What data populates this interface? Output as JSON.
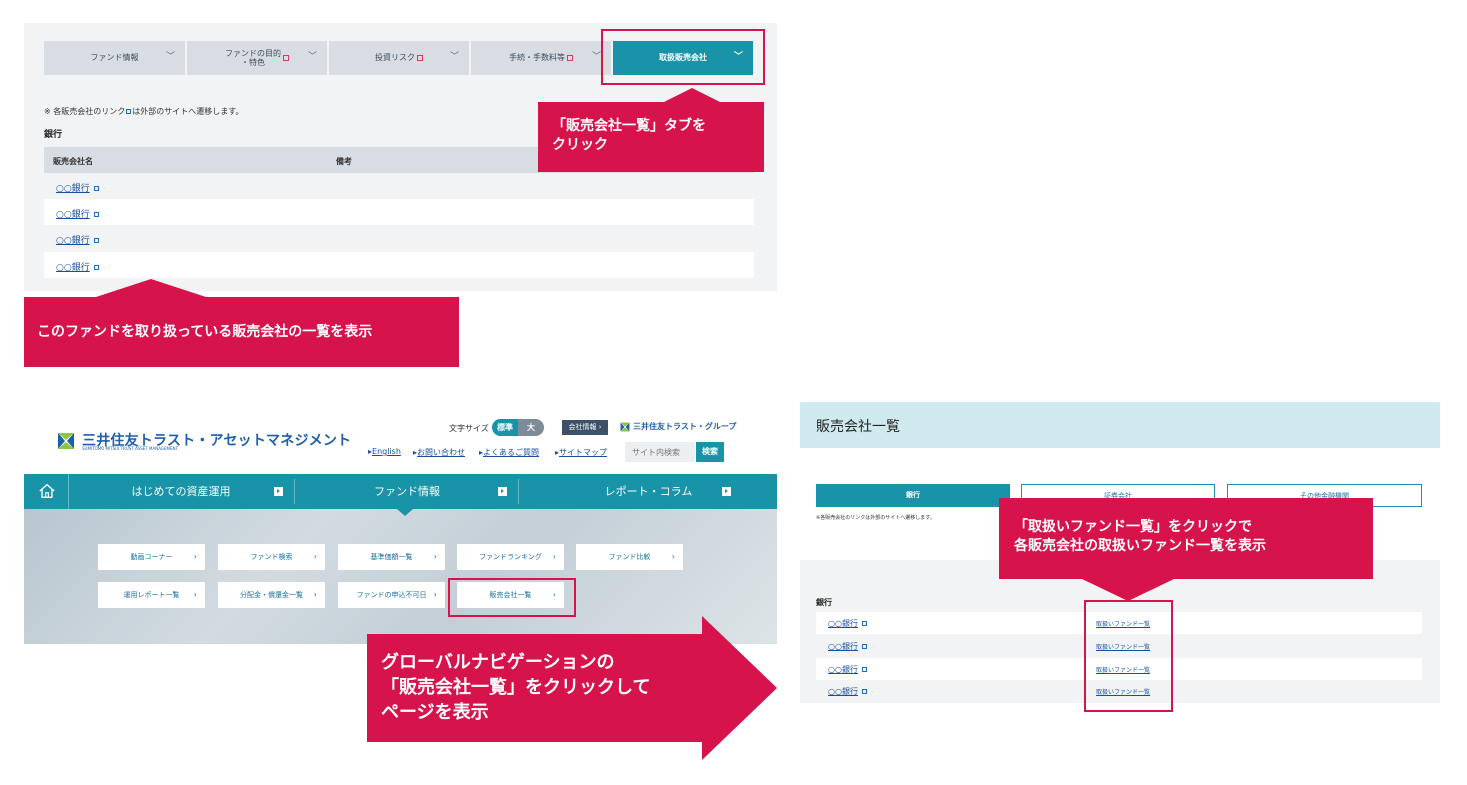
{
  "colors": {
    "accent": "#1893a8",
    "callout": "#d6134b",
    "panel_bg": "#f1f3f4",
    "tab_bg": "#d8dde3",
    "header_bg": "#cfeaee"
  },
  "panel1": {
    "tabs": [
      {
        "label": "ファンド情報",
        "icon": "chevron-down-icon"
      },
      {
        "label": "ファンドの目的\n・特色",
        "icon": "chevron-down-icon"
      },
      {
        "label": "投資リスク",
        "icon": "chevron-down-icon"
      },
      {
        "label": "手続・手数料等",
        "icon": "chevron-down-icon"
      },
      {
        "label": "取扱販売会社",
        "icon": "chevron-down-icon"
      }
    ],
    "note_prefix": "※ 各販売会社のリンク",
    "note_suffix": "は外部のサイトへ遷移します。",
    "bank_section": "銀行",
    "columns": [
      "販売会社名",
      "備考"
    ],
    "rows": [
      "○○銀行",
      "○○銀行",
      "○○銀行",
      "○○銀行"
    ]
  },
  "callouts": {
    "tab_click": "「販売会社一覧」タブを\nクリック",
    "list_shown": "このファンドを取り扱っている販売会社の一覧を表示",
    "gnav_click": "グローバルナビゲーションの\n「販売会社一覧」をクリックして\nページを表示",
    "fund_list_click": "「取扱いファンド一覧」をクリックで\n各販売会社の取扱いファンド一覧を表示"
  },
  "header": {
    "logo_text": "三井住友トラスト・アセットマネジメント",
    "logo_sub": "SUMITOMO MITSUI TRUST ASSET MANAGEMENT",
    "font_size_label": "文字サイズ",
    "size_standard": "標準",
    "size_large": "大",
    "company_info": "会社情報 ›",
    "group_logo": "三井住友トラスト・グループ",
    "links": [
      "English",
      "お問い合わせ",
      "よくあるご質問",
      "サイトマップ"
    ],
    "search_placeholder": "サイト内検索",
    "search_button": "検索"
  },
  "gnav": {
    "items": [
      "はじめての資産運用",
      "ファンド情報",
      "レポート・コラム"
    ],
    "mega_menu": [
      "動画コーナー",
      "ファンド検索",
      "基準価額一覧",
      "ファンドランキング",
      "ファンド比較",
      "運用レポート一覧",
      "分配金・償還金一覧",
      "ファンドの申込不可日",
      "販売会社一覧"
    ]
  },
  "panel3": {
    "title": "販売会社一覧",
    "tabs": [
      "銀行",
      "証券会社",
      "その他金融機関"
    ],
    "note": "※各販売会社のリンクは外部のサイトへ遷移します。",
    "bank_section": "銀行",
    "rows": [
      {
        "name": "○○銀行",
        "link": "取扱いファンド一覧"
      },
      {
        "name": "○○銀行",
        "link": "取扱いファンド一覧"
      },
      {
        "name": "○○銀行",
        "link": "取扱いファンド一覧"
      },
      {
        "name": "○○銀行",
        "link": "取扱いファンド一覧"
      }
    ]
  }
}
